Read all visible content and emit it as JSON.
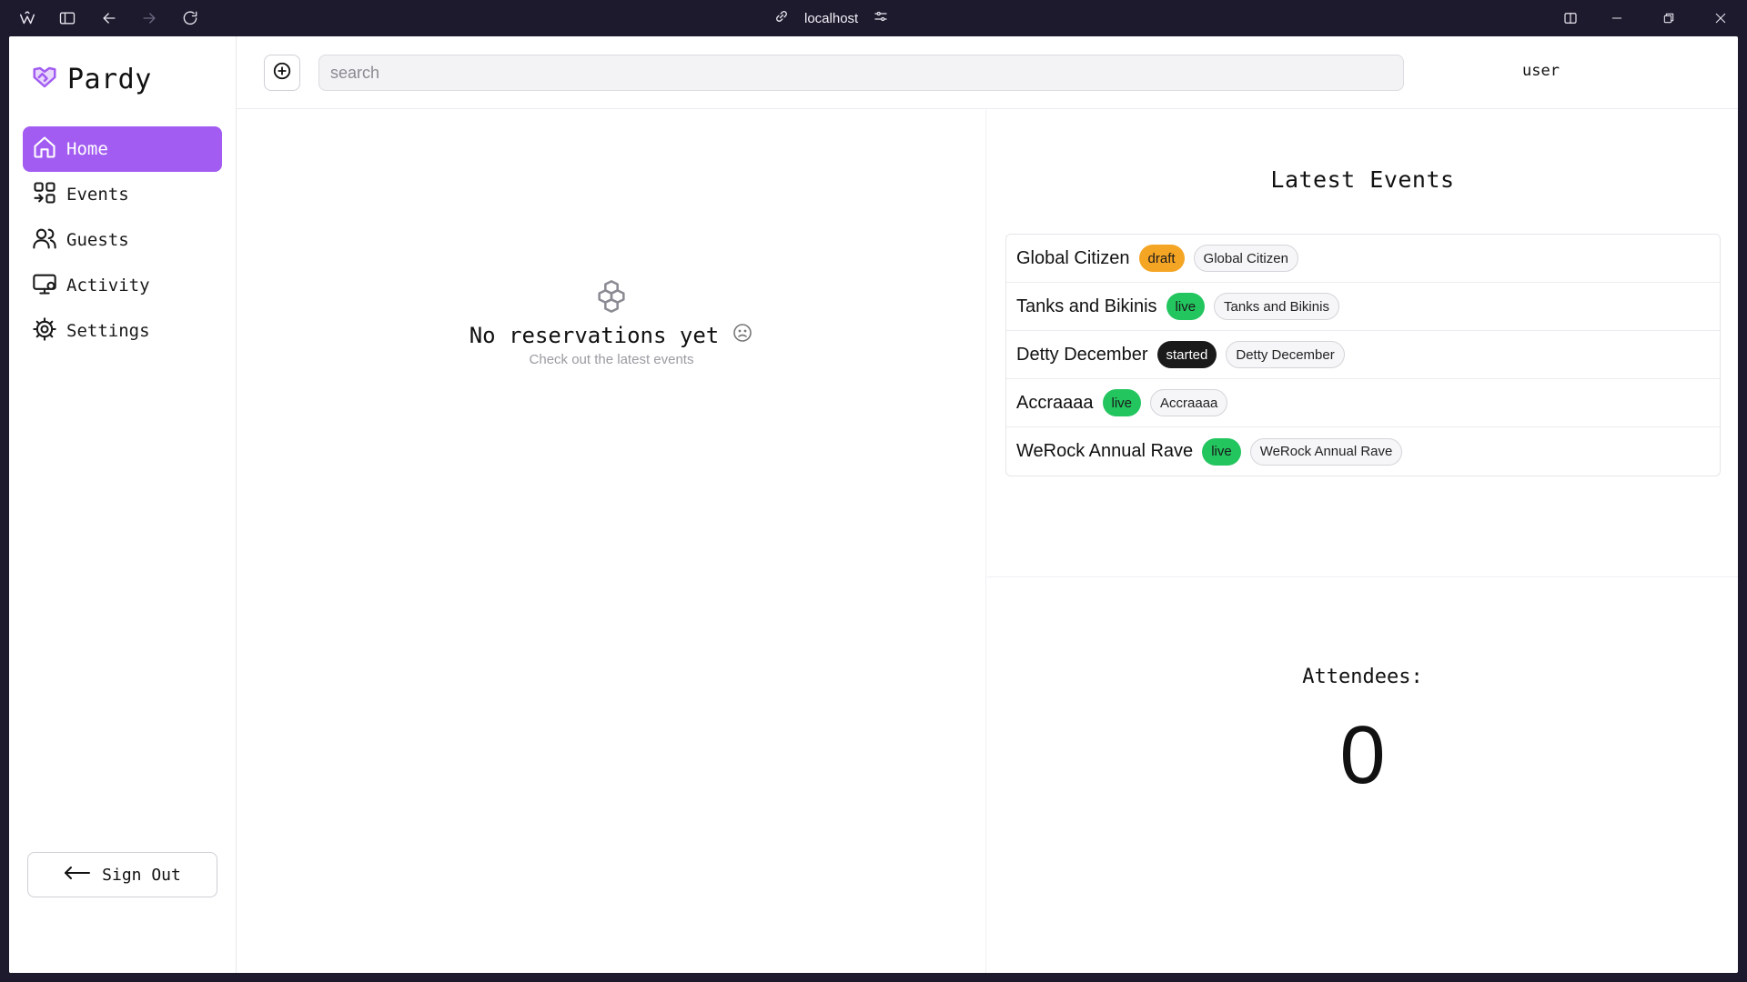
{
  "browser": {
    "url": "localhost"
  },
  "app": {
    "name": "Pardy"
  },
  "sidebar": {
    "items": [
      {
        "label": "Home",
        "icon": "home-icon",
        "active": true
      },
      {
        "label": "Events",
        "icon": "grid-icon",
        "active": false
      },
      {
        "label": "Guests",
        "icon": "users-icon",
        "active": false
      },
      {
        "label": "Activity",
        "icon": "monitor-icon",
        "active": false
      },
      {
        "label": "Settings",
        "icon": "cog-icon",
        "active": false
      }
    ],
    "signout_label": "Sign Out"
  },
  "header": {
    "search_placeholder": "search",
    "user_label": "user"
  },
  "empty_state": {
    "title": "No reservations yet",
    "subtitle": "Check out the latest events"
  },
  "latest_events": {
    "title": "Latest Events",
    "items": [
      {
        "name": "Global Citizen",
        "status": "draft",
        "tag": "Global Citizen",
        "status_color": "#f5a524"
      },
      {
        "name": "Tanks and Bikinis",
        "status": "live",
        "tag": "Tanks and Bikinis",
        "status_color": "#22c55e"
      },
      {
        "name": "Detty December",
        "status": "started",
        "tag": "Detty December",
        "status_color": "#1a1a1a"
      },
      {
        "name": "Accraaaa",
        "status": "live",
        "tag": "Accraaaa",
        "status_color": "#22c55e"
      },
      {
        "name": "WeRock Annual Rave",
        "status": "live",
        "tag": "WeRock Annual Rave",
        "status_color": "#22c55e"
      }
    ]
  },
  "attendees": {
    "label": "Attendees:",
    "value": "0"
  },
  "colors": {
    "accent": "#a25cf2",
    "chrome_bg": "#1e1a2e"
  }
}
